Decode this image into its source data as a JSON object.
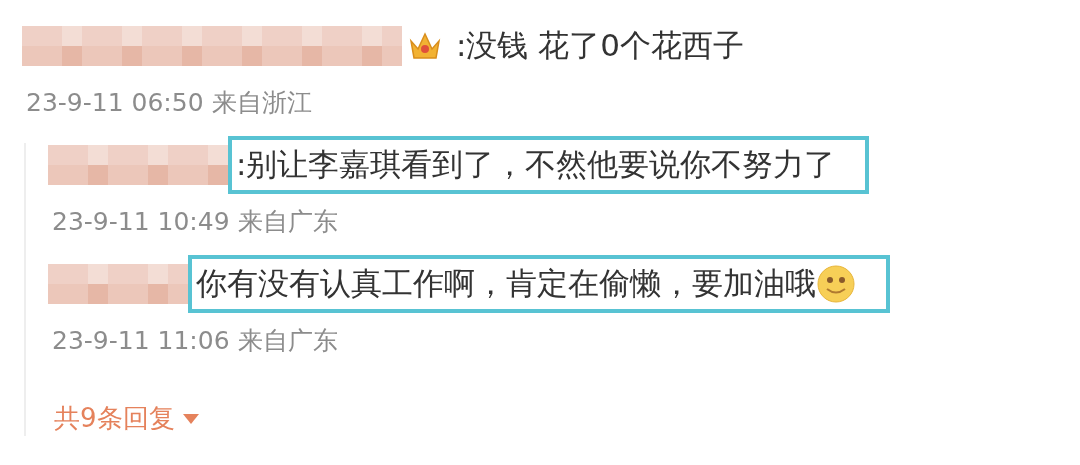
{
  "comment": {
    "badge": true,
    "text": ":没钱 花了0个花西子",
    "time": "23-9-11 06:50 来自浙江",
    "highlighted": false
  },
  "replies": [
    {
      "text": ":别让李嘉琪看到了，不然他要说你不努力了",
      "time": "23-9-11 10:49 来自广东",
      "highlighted": true,
      "emoji": false
    },
    {
      "text": "你有没有认真工作啊，肯定在偷懒，要加油哦",
      "time": "23-9-11 11:06 来自广东",
      "highlighted": true,
      "emoji": true
    }
  ],
  "more_replies": {
    "label": "共9条回复"
  }
}
